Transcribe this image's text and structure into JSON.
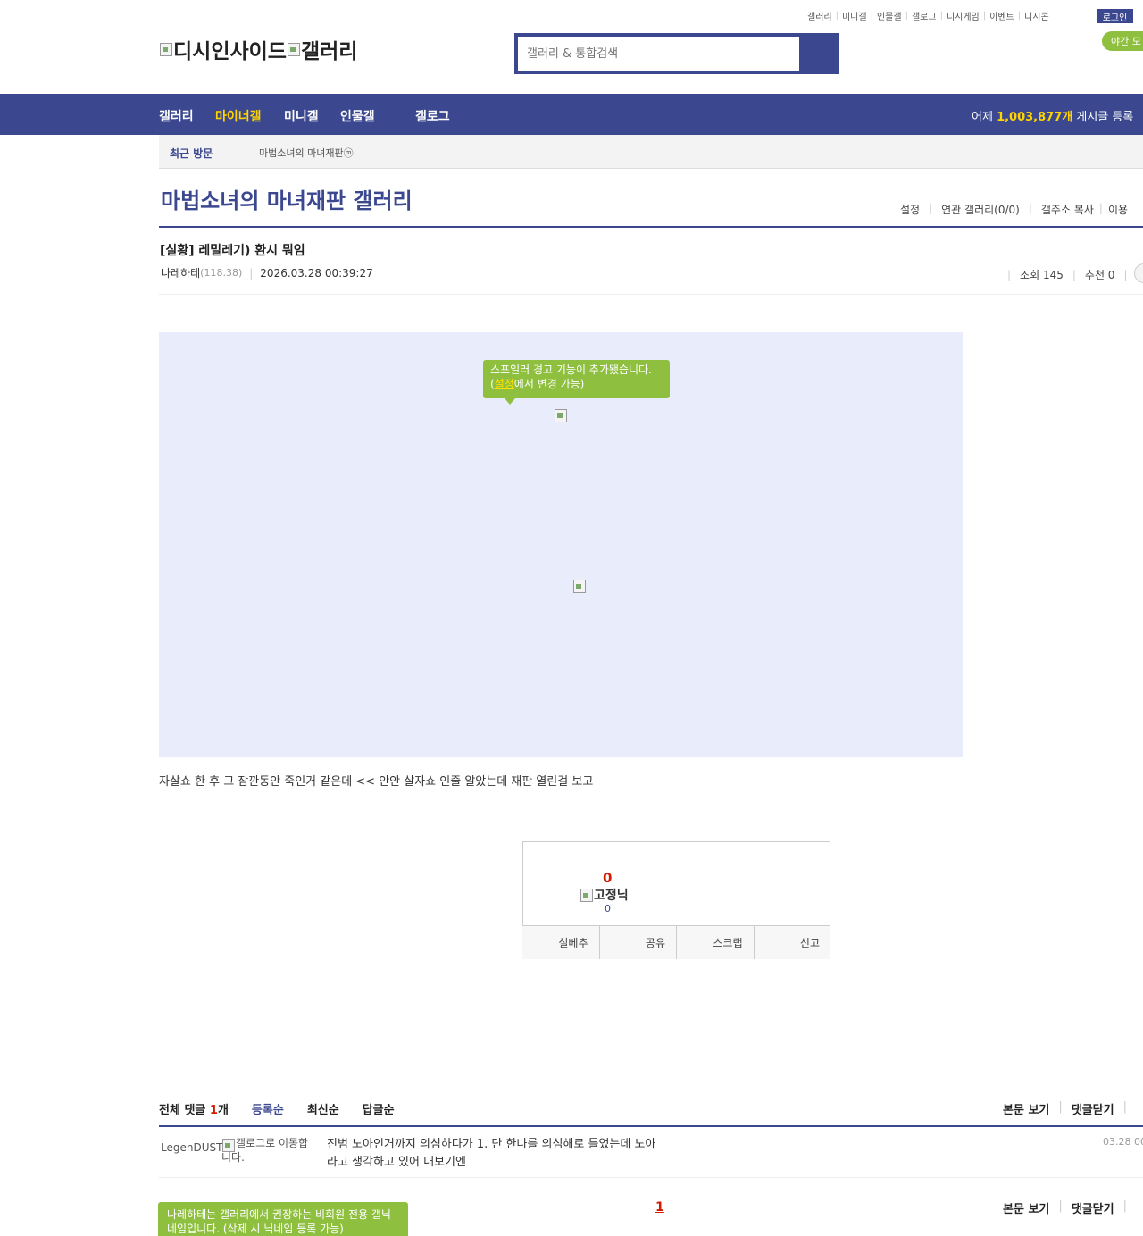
{
  "top_links": [
    "갤러리",
    "미니갤",
    "인물갤",
    "갤로그",
    "디시게임",
    "이벤트",
    "디시콘"
  ],
  "login_label": "로그인",
  "night_mode_label": "야간 모",
  "logo": {
    "site": "디시인사이드",
    "section": "갤러리"
  },
  "search": {
    "placeholder": "갤러리 & 통합검색"
  },
  "gnb": {
    "items": [
      "갤러리",
      "마이너갤",
      "미니갤",
      "인물갤",
      "갤로그"
    ],
    "stat_prefix": "어제",
    "stat_count": "1,003,877개",
    "stat_suffix": "게시글 등록"
  },
  "recent": {
    "label": "최근 방문",
    "item": "마법소녀의 마녀재판ⓜ"
  },
  "gallery": {
    "title": "마법소녀의 마녀재판 갤러리",
    "links": [
      "설정",
      "연관 갤러리(0/0)",
      "갤주소 복사",
      "이용"
    ]
  },
  "post": {
    "title": "[실황] 레밀레기) 환시 뭐임",
    "author": "나레하테",
    "ip": "(118.38)",
    "datetime": "2026.03.28 00:39:27",
    "views_label": "조회 145",
    "recommend_label": "추천 0",
    "tooltip_line1": "스포일러 경고 기능이 추가됐습니다.",
    "tooltip_link": "설정",
    "tooltip_line2": "에서 변경 가능)",
    "tooltip_open": "(",
    "body": "자살쇼 한 후 그 잠깐동안 죽인거 같은데 << 안안 살자쇼 인줄 알았는데 재판 열린걸 보고"
  },
  "recommend": {
    "count": "0",
    "fix_label": "고정닉",
    "fix_count": "0",
    "buttons": [
      "실베추",
      "공유",
      "스크랩",
      "신고"
    ]
  },
  "comments": {
    "total_label": "전체 댓글",
    "total_count": "1",
    "total_unit": "개",
    "sort": [
      "등록순",
      "최신순",
      "답글순"
    ],
    "actions": [
      "본문 보기",
      "댓글닫기"
    ],
    "items": [
      {
        "nick": "LegenDUST",
        "gallog_alt": "갤로그로 이동합니다.",
        "text": "진범 노아인거까지 의심하다가 1. 단 한나를 의심해로 틀었는데 노아라고 생각하고 있어 내보기엔",
        "date": "03.28 00"
      }
    ],
    "page": "1"
  },
  "nick_tip": "나레하테는 갤러리에서 권장하는 비회원 전용 갤닉네임입니다. (삭제 시 닉네임 등록 가능)",
  "colors": {
    "brand": "#3b4890",
    "accent": "#ffd400",
    "green": "#8fbf3f",
    "red": "#d31900"
  }
}
